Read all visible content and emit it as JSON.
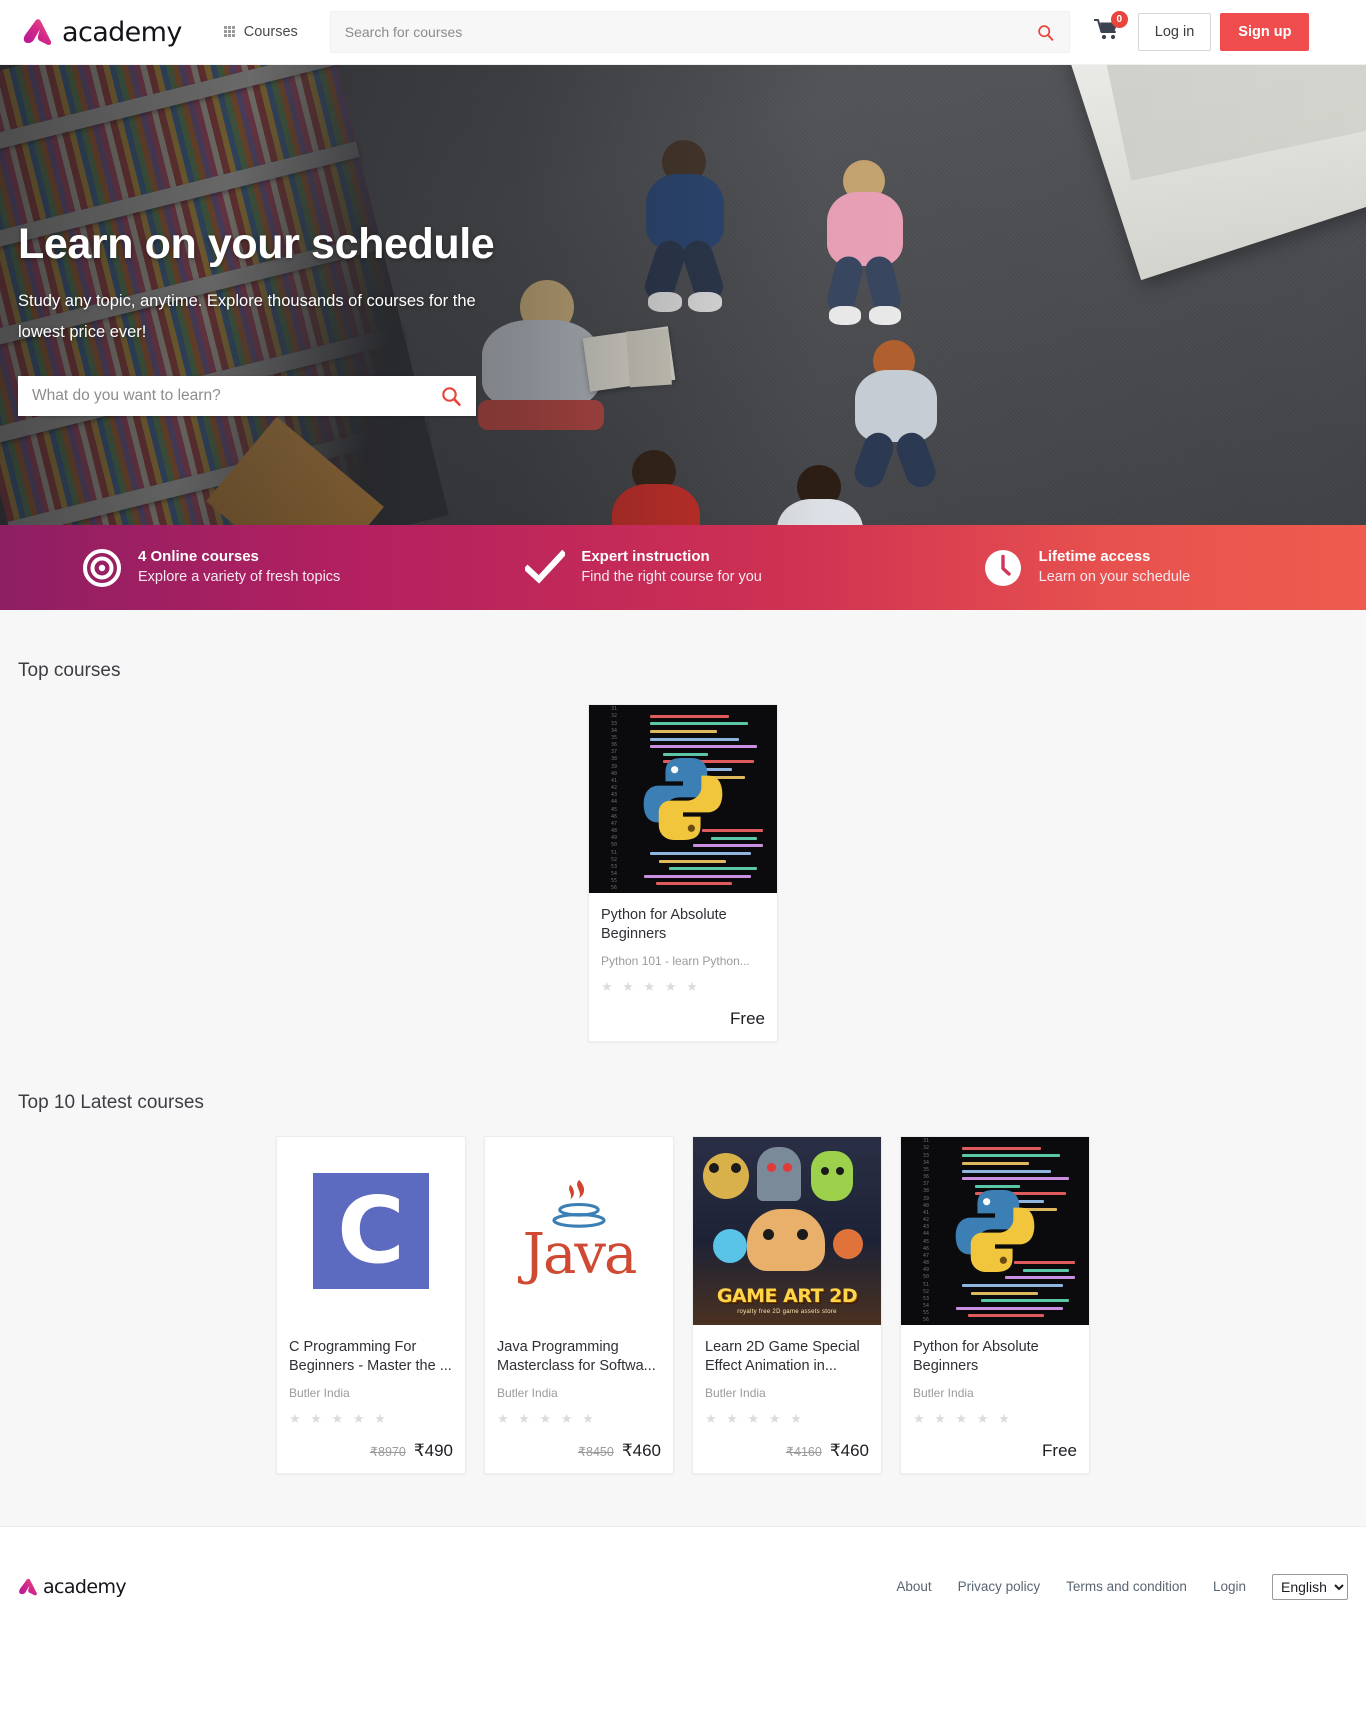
{
  "header": {
    "logo_text": "academy",
    "logo_icon": "academy-a-logo",
    "nav": {
      "courses_label": "Courses",
      "courses_icon": "grid-icon"
    },
    "search": {
      "placeholder": "Search for courses",
      "value": "",
      "icon": "search-icon"
    },
    "cart": {
      "icon": "shopping-cart-icon",
      "badge": "0"
    },
    "login_label": "Log in",
    "signup_label": "Sign up",
    "accent": "#ef4d4d"
  },
  "hero": {
    "title": "Learn on your schedule",
    "subtitle": "Study any topic, anytime. Explore thousands of courses for the lowest price ever!",
    "search": {
      "placeholder": "What do you want to learn?",
      "value": "",
      "icon": "search-icon"
    }
  },
  "features": {
    "gradient_from": "#8e1f63",
    "gradient_to": "#ef5b4e",
    "items": [
      {
        "icon": "target-icon",
        "title": "4 Online courses",
        "subtitle": "Explore a variety of fresh topics"
      },
      {
        "icon": "check-icon",
        "title": "Expert instruction",
        "subtitle": "Find the right course for you"
      },
      {
        "icon": "clock-icon",
        "title": "Lifetime access",
        "subtitle": "Learn on your schedule"
      }
    ]
  },
  "top_courses": {
    "heading": "Top courses",
    "cards": [
      {
        "thumb": "python-code-thumb",
        "title": "Python for Absolute Beginners",
        "meta": "Python 101 - learn Python...",
        "rating_stars": "★ ★ ★ ★ ★",
        "price_old": "",
        "price_new": "Free"
      }
    ]
  },
  "latest_courses": {
    "heading": "Top 10 Latest courses",
    "cards": [
      {
        "thumb": "c-language-thumb",
        "thumb_letter": "C",
        "title": "C Programming For Beginners - Master the ...",
        "meta": "Butler India",
        "rating_stars": "★ ★ ★ ★ ★",
        "price_old": "₹8970",
        "price_new": "₹490"
      },
      {
        "thumb": "java-logo-thumb",
        "thumb_letter": "Java",
        "title": "Java Programming Masterclass for Softwa...",
        "meta": "Butler India",
        "rating_stars": "★ ★ ★ ★ ★",
        "price_old": "₹8450",
        "price_new": "₹460"
      },
      {
        "thumb": "game-art-2d-thumb",
        "thumb_letter": "GAME ART 2D",
        "thumb_caption": "royalty free 2D game assets store",
        "title": "Learn 2D Game Special Effect Animation in...",
        "meta": "Butler India",
        "rating_stars": "★ ★ ★ ★ ★",
        "price_old": "₹4160",
        "price_new": "₹460"
      },
      {
        "thumb": "python-code-thumb",
        "thumb_letter": "",
        "title": "Python for Absolute Beginners",
        "meta": "Butler India",
        "rating_stars": "★ ★ ★ ★ ★",
        "price_old": "",
        "price_new": "Free"
      }
    ]
  },
  "footer": {
    "logo_text": "academy",
    "links": [
      {
        "label": "About"
      },
      {
        "label": "Privacy policy"
      },
      {
        "label": "Terms and condition"
      },
      {
        "label": "Login"
      }
    ],
    "language": {
      "selected": "English",
      "options": [
        "English"
      ]
    }
  }
}
